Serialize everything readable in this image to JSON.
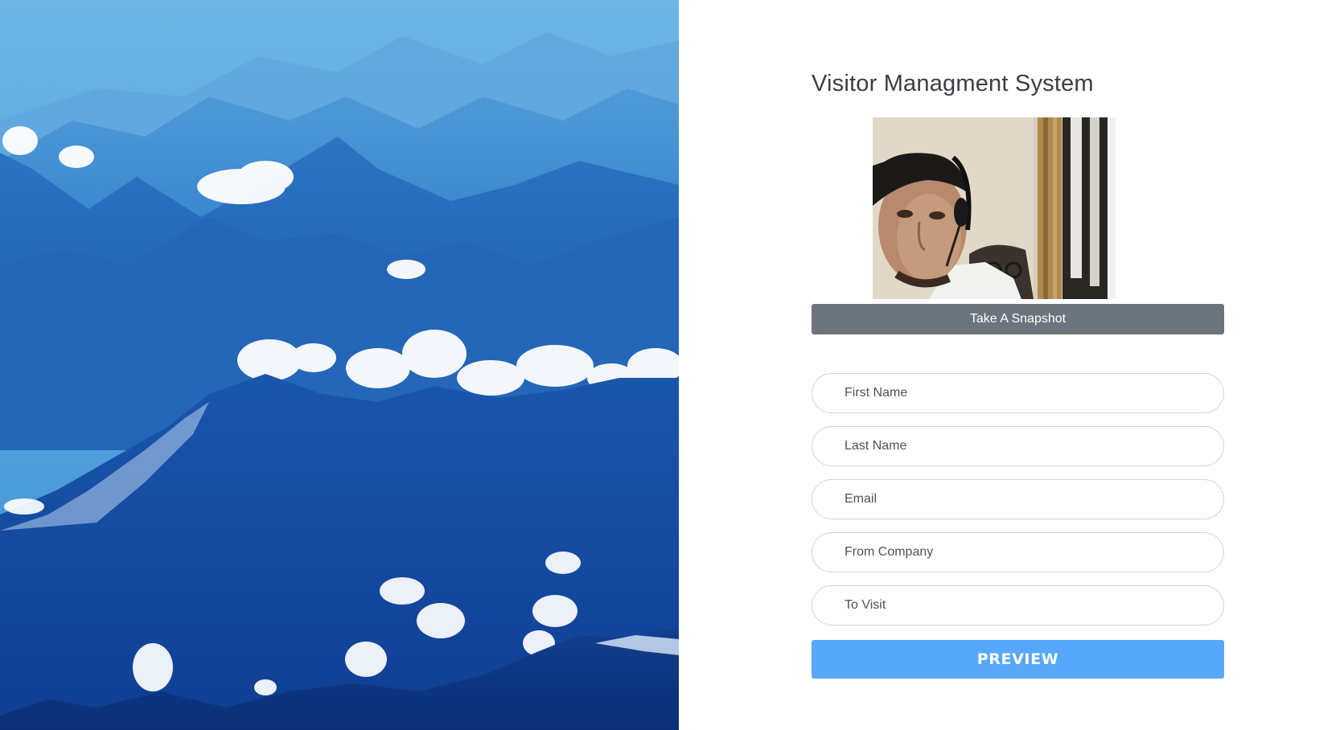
{
  "hero": {
    "image": "mountain-landscape-photo"
  },
  "form": {
    "title": "Visitor Managment System",
    "camera": "webcam-live-feed",
    "snapshot_label": "Take A Snapshot",
    "fields": [
      {
        "name": "first-name-input",
        "placeholder": "First Name",
        "value": ""
      },
      {
        "name": "last-name-input",
        "placeholder": "Last Name",
        "value": ""
      },
      {
        "name": "email-input",
        "placeholder": "Email",
        "value": ""
      },
      {
        "name": "from-company-input",
        "placeholder": "From Company",
        "value": ""
      },
      {
        "name": "to-visit-input",
        "placeholder": "To Visit",
        "value": ""
      }
    ],
    "preview_label": "PREVIEW"
  },
  "colors": {
    "snapshot_button": "#6c757d",
    "preview_button": "#57a7fb",
    "field_border": "#cfd4d9",
    "title_text": "#3b3f44"
  }
}
